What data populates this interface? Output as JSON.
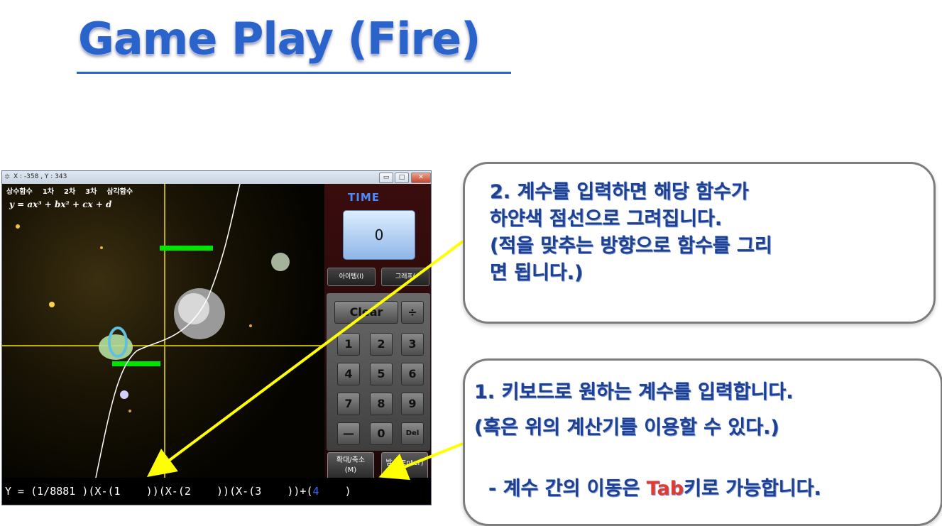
{
  "slide": {
    "title": "Game Play (Fire)"
  },
  "window": {
    "title": "X : -358 , Y : 343",
    "buttons": {
      "minimize": "▭",
      "maximize": "□",
      "close": "✕"
    },
    "menu": [
      "상수함수",
      "1차",
      "2차",
      "3차",
      "삼각함수"
    ],
    "equation": "y = ax³ + bx² + cx + d",
    "time_label": "TIME",
    "time_value": "0",
    "item_button": "아이템(I)",
    "graph_button": "그래프(",
    "calc": {
      "clear": "Clear",
      "divide": "÷",
      "keys": [
        "1",
        "2",
        "3",
        "4",
        "5",
        "6",
        "7",
        "8",
        "9"
      ],
      "minus": "—",
      "zero": "0",
      "del": "Del"
    },
    "zoom_button": "확대/축소\n(M)",
    "fire_button": "발사(Enter)",
    "input": {
      "prefix": "Y = (1/8881 )(X-(1    ))(X-(2    ))(X-(3    ))+(",
      "active": "4",
      "suffix": "    )"
    }
  },
  "callouts": {
    "top": "2. 계수를 입력하면 해당 함수가\n하얀색 점선으로 그려집니다.\n(적을 맞추는 방향으로 함수를 그리\n면 됩니다.)",
    "bottom_line1": "1. 키보드로 원하는 계수를 입력합니다.",
    "bottom_line2": "(혹은 위의 계산기를 이용할 수 있다.)",
    "bottom_prefix": "- 계수 간의 이동은 ",
    "bottom_tab": "Tab",
    "bottom_suffix": "키로 가능합니다."
  },
  "colors": {
    "title": "#2a63c9",
    "callout_text": "#1f3f8f",
    "tab_highlight": "#e23a2c",
    "arrow": "#ffff00",
    "health_bar": "#00e600",
    "axis": "#b9b000"
  }
}
